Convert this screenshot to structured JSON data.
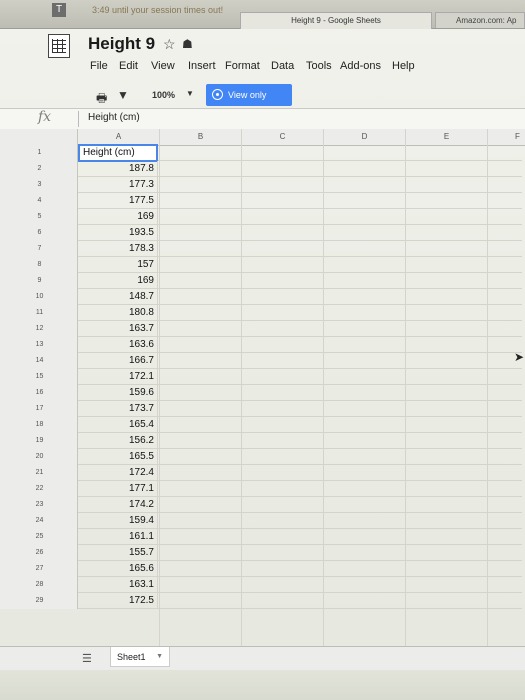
{
  "top_bar": {
    "session_text": "3:49 until your session times out!",
    "tab_active": "Height 9 - Google Sheets",
    "tab_other": "Amazon.com: Ap"
  },
  "document": {
    "title": "Height 9",
    "star_icon": "star-icon",
    "drive_icon": "drive-icon"
  },
  "menu": {
    "items": [
      "File",
      "Edit",
      "View",
      "Insert",
      "Format",
      "Data",
      "Tools",
      "Add-ons",
      "Help"
    ]
  },
  "toolbar": {
    "print_icon": "print-icon",
    "filter_icon": "filter-icon",
    "zoom": "100%",
    "view_only_label": "View only",
    "accent_color": "#4285f4"
  },
  "formula_bar": {
    "fx_label": "fx",
    "value": "Height (cm)"
  },
  "grid": {
    "columns": [
      "A",
      "B",
      "C",
      "D",
      "E",
      "F"
    ],
    "rows": [
      {
        "n": "1",
        "a": "Height (cm)"
      },
      {
        "n": "2",
        "a": "187.8"
      },
      {
        "n": "3",
        "a": "177.3"
      },
      {
        "n": "4",
        "a": "177.5"
      },
      {
        "n": "5",
        "a": "169"
      },
      {
        "n": "6",
        "a": "193.5"
      },
      {
        "n": "7",
        "a": "178.3"
      },
      {
        "n": "8",
        "a": "157"
      },
      {
        "n": "9",
        "a": "169"
      },
      {
        "n": "10",
        "a": "148.7"
      },
      {
        "n": "11",
        "a": "180.8"
      },
      {
        "n": "12",
        "a": "163.7"
      },
      {
        "n": "13",
        "a": "163.6"
      },
      {
        "n": "14",
        "a": "166.7"
      },
      {
        "n": "15",
        "a": "172.1"
      },
      {
        "n": "16",
        "a": "159.6"
      },
      {
        "n": "17",
        "a": "173.7"
      },
      {
        "n": "18",
        "a": "165.4"
      },
      {
        "n": "19",
        "a": "156.2"
      },
      {
        "n": "20",
        "a": "165.5"
      },
      {
        "n": "21",
        "a": "172.4"
      },
      {
        "n": "22",
        "a": "177.1"
      },
      {
        "n": "23",
        "a": "174.2"
      },
      {
        "n": "24",
        "a": "159.4"
      },
      {
        "n": "25",
        "a": "161.1"
      },
      {
        "n": "26",
        "a": "155.7"
      },
      {
        "n": "27",
        "a": "165.6"
      },
      {
        "n": "28",
        "a": "163.1"
      },
      {
        "n": "29",
        "a": "172.5"
      }
    ]
  },
  "sheet_bar": {
    "menu_icon": "sheets-list-icon",
    "tab_label": "Sheet1"
  }
}
